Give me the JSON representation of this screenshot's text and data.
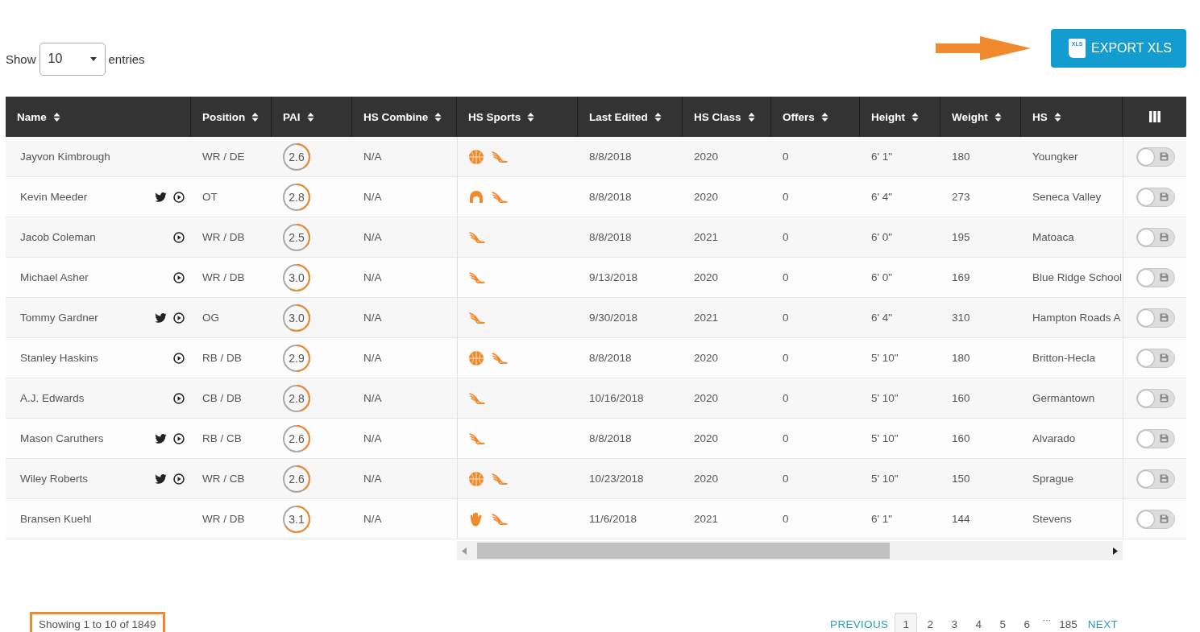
{
  "length_control": {
    "prefix": "Show",
    "value": "10",
    "suffix": "entries"
  },
  "export_button": {
    "icon_text": "XLS",
    "label": "EXPORT XLS"
  },
  "table": {
    "columns": [
      {
        "label": "Name"
      },
      {
        "label": "Position"
      },
      {
        "label": "PAI"
      },
      {
        "label": "HS Combine"
      },
      {
        "label": "HS Sports"
      },
      {
        "label": "Last Edited"
      },
      {
        "label": "HS Class"
      },
      {
        "label": "Offers"
      },
      {
        "label": "Height"
      },
      {
        "label": "Weight"
      },
      {
        "label": "HS"
      }
    ],
    "rows": [
      {
        "name": "Jayvon Kimbrough",
        "twitter": false,
        "video": false,
        "position": "WR / DE",
        "pai": "2.6",
        "level": 0.5,
        "hs_combine": "N/A",
        "sports": [
          {
            "kind": "basketball"
          },
          {
            "kind": "winged-shoe"
          }
        ],
        "last_edited": "8/8/2018",
        "hs_class": "2020",
        "offers": "0",
        "height": "6' 1\"",
        "weight": "180",
        "hs": "Youngker",
        "saved": false
      },
      {
        "name": "Kevin Meeder",
        "twitter": true,
        "video": true,
        "position": "OT",
        "pai": "2.8",
        "level": 0.55,
        "hs_combine": "N/A",
        "sports": [
          {
            "kind": "helmet"
          },
          {
            "kind": "winged-shoe"
          }
        ],
        "last_edited": "8/8/2018",
        "hs_class": "2020",
        "offers": "0",
        "height": "6' 4\"",
        "weight": "273",
        "hs": "Seneca Valley",
        "saved": false
      },
      {
        "name": "Jacob Coleman",
        "twitter": false,
        "video": true,
        "position": "WR / DB",
        "pai": "2.5",
        "level": 0.45,
        "hs_combine": "N/A",
        "sports": [
          {
            "kind": "winged-shoe"
          }
        ],
        "last_edited": "8/8/2018",
        "hs_class": "2021",
        "offers": "0",
        "height": "6' 0\"",
        "weight": "195",
        "hs": "Matoaca",
        "saved": false
      },
      {
        "name": "Michael Asher",
        "twitter": false,
        "video": true,
        "position": "WR / DB",
        "pai": "3.0",
        "level": 0.7,
        "hs_combine": "N/A",
        "sports": [
          {
            "kind": "winged-shoe"
          }
        ],
        "last_edited": "9/13/2018",
        "hs_class": "2020",
        "offers": "0",
        "height": "6' 0\"",
        "weight": "169",
        "hs": "Blue Ridge School",
        "saved": false
      },
      {
        "name": "Tommy Gardner",
        "twitter": true,
        "video": true,
        "position": "OG",
        "pai": "3.0",
        "level": 0.7,
        "hs_combine": "N/A",
        "sports": [
          {
            "kind": "winged-shoe"
          }
        ],
        "last_edited": "9/30/2018",
        "hs_class": "2021",
        "offers": "0",
        "height": "6' 4\"",
        "weight": "310",
        "hs": "Hampton Roads A",
        "saved": false
      },
      {
        "name": "Stanley Haskins",
        "twitter": false,
        "video": true,
        "position": "RB / DB",
        "pai": "2.9",
        "level": 0.6,
        "hs_combine": "N/A",
        "sports": [
          {
            "kind": "basketball"
          },
          {
            "kind": "winged-shoe"
          }
        ],
        "last_edited": "8/8/2018",
        "hs_class": "2020",
        "offers": "0",
        "height": "5' 10\"",
        "weight": "180",
        "hs": "Britton-Hecla",
        "saved": false
      },
      {
        "name": "A.J. Edwards",
        "twitter": false,
        "video": true,
        "position": "CB / DB",
        "pai": "2.8",
        "level": 0.55,
        "hs_combine": "N/A",
        "sports": [
          {
            "kind": "winged-shoe"
          }
        ],
        "last_edited": "10/16/2018",
        "hs_class": "2020",
        "offers": "0",
        "height": "5' 10\"",
        "weight": "160",
        "hs": "Germantown",
        "saved": false
      },
      {
        "name": "Mason Caruthers",
        "twitter": true,
        "video": true,
        "position": "RB / CB",
        "pai": "2.6",
        "level": 0.5,
        "hs_combine": "N/A",
        "sports": [
          {
            "kind": "winged-shoe"
          }
        ],
        "last_edited": "8/8/2018",
        "hs_class": "2020",
        "offers": "0",
        "height": "5' 10\"",
        "weight": "160",
        "hs": "Alvarado",
        "saved": false
      },
      {
        "name": "Wiley Roberts",
        "twitter": true,
        "video": true,
        "position": "WR / CB",
        "pai": "2.6",
        "level": 0.5,
        "hs_combine": "N/A",
        "sports": [
          {
            "kind": "basketball"
          },
          {
            "kind": "winged-shoe"
          }
        ],
        "last_edited": "10/23/2018",
        "hs_class": "2020",
        "offers": "0",
        "height": "5' 10\"",
        "weight": "150",
        "hs": "Sprague",
        "saved": false
      },
      {
        "name": "Bransen Kuehl",
        "twitter": false,
        "video": false,
        "position": "WR / DB",
        "pai": "3.1",
        "level": 0.8,
        "hs_combine": "N/A",
        "sports": [
          {
            "kind": "glove"
          },
          {
            "kind": "winged-shoe"
          }
        ],
        "last_edited": "11/6/2018",
        "hs_class": "2021",
        "offers": "0",
        "height": "6' 1\"",
        "weight": "144",
        "hs": "Stevens",
        "saved": false
      }
    ]
  },
  "info": "Showing 1 to 10 of 1849",
  "pagination": {
    "previous": "PREVIOUS",
    "next": "NEXT",
    "ellipsis": "···",
    "pages": [
      {
        "label": "1",
        "selected": true
      },
      {
        "label": "2",
        "selected": false
      },
      {
        "label": "3",
        "selected": false
      },
      {
        "label": "4",
        "selected": false
      },
      {
        "label": "5",
        "selected": false
      },
      {
        "label": "6",
        "selected": false
      },
      {
        "label": "185",
        "selected": false
      }
    ]
  }
}
